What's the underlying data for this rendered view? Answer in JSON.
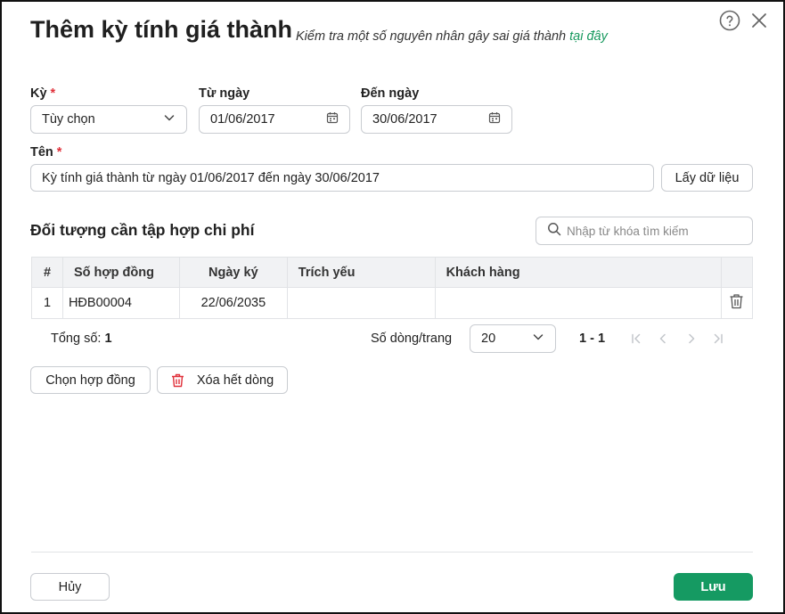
{
  "dialog": {
    "title": "Thêm kỳ tính giá thành",
    "subtitle": "Kiểm tra một số nguyên nhân gây sai giá thành",
    "subtitle_link": "tại đây"
  },
  "form": {
    "period_label": "Kỳ",
    "period_value": "Tùy chọn",
    "from_label": "Từ ngày",
    "from_value": "01/06/2017",
    "to_label": "Đến ngày",
    "to_value": "30/06/2017",
    "name_label": "Tên",
    "name_value": "Kỳ tính giá thành từ ngày 01/06/2017 đến ngày 30/06/2017",
    "required_mark": "*",
    "fetch_button": "Lấy dữ liệu"
  },
  "section": {
    "title": "Đối tượng cần tập hợp chi phí",
    "search_placeholder": "Nhập từ khóa tìm kiếm"
  },
  "table": {
    "columns": [
      "#",
      "Số hợp đồng",
      "Ngày ký",
      "Trích yếu",
      "Khách hàng"
    ],
    "rows": [
      {
        "index": "1",
        "contract_no": "HĐB00004",
        "sign_date": "22/06/2035",
        "summary": "",
        "customer": ""
      }
    ]
  },
  "pagination": {
    "total_label": "Tổng số:",
    "total_value": "1",
    "rows_per_page_label": "Số dòng/trang",
    "rows_per_page_value": "20",
    "range": "1 - 1"
  },
  "actions": {
    "choose_contract": "Chọn hợp đồng",
    "delete_all": "Xóa hết dòng",
    "cancel": "Hủy",
    "save": "Lưu"
  },
  "colors": {
    "primary": "#159a62",
    "link": "#17995e",
    "required": "#e0303a",
    "delete_icon": "#e0303a"
  }
}
